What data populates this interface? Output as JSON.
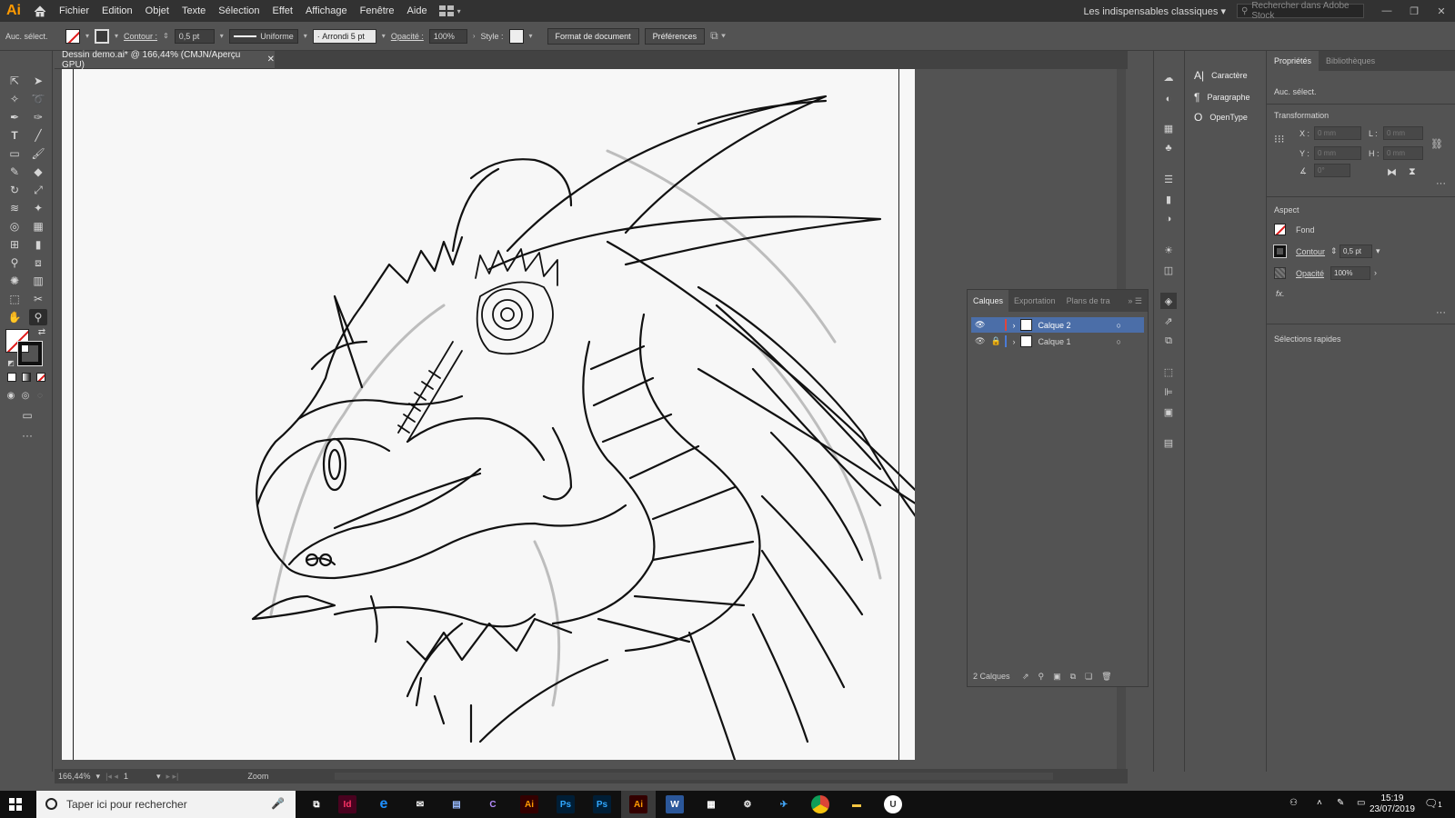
{
  "app": {
    "logo": "Ai",
    "accent": "#ff9a00"
  },
  "menubar": {
    "items": [
      "Fichier",
      "Edition",
      "Objet",
      "Texte",
      "Sélection",
      "Effet",
      "Affichage",
      "Fenêtre",
      "Aide"
    ],
    "workspace": "Les indispensables classiques",
    "stock_search_placeholder": "Rechercher dans Adobe Stock"
  },
  "controlbar": {
    "selection": "Auc. sélect.",
    "contour_label": "Contour :",
    "contour_value": "0,5 pt",
    "stroke_profile": "Uniforme",
    "brush": "Arrondi 5 pt",
    "opacity_label": "Opacité :",
    "opacity_value": "100%",
    "style_label": "Style :",
    "doc_format_button": "Format de document",
    "preferences_button": "Préférences"
  },
  "document": {
    "tab_title": "Dessin demo.ai* @ 166,44% (CMJN/Aperçu GPU)"
  },
  "statusbar": {
    "zoom": "166,44%",
    "artboard": "1",
    "tool": "Zoom"
  },
  "layers_panel": {
    "tabs": [
      "Calques",
      "Exportation",
      "Plans de tra"
    ],
    "layers": [
      {
        "name": "Calque 2",
        "selected": true,
        "color": "#e0463c",
        "locked": false
      },
      {
        "name": "Calque 1",
        "selected": false,
        "color": "#4b7bd6",
        "locked": true
      }
    ],
    "count": "2 Calques"
  },
  "char_panel": {
    "items": [
      "Caractère",
      "Paragraphe",
      "OpenType"
    ]
  },
  "properties": {
    "tabs": [
      "Propriétés",
      "Bibliothèques"
    ],
    "selection": "Auc. sélect.",
    "transform_heading": "Transformation",
    "x_label": "X :",
    "y_label": "Y :",
    "l_label": "L :",
    "h_label": "H :",
    "x_value": "0 mm",
    "y_value": "0 mm",
    "l_value": "0 mm",
    "h_value": "0 mm",
    "angle_value": "0°",
    "aspect_heading": "Aspect",
    "fill_label": "Fond",
    "stroke_label": "Contour",
    "stroke_value": "0,5 pt",
    "opacity_label": "Opacité",
    "opacity_value": "100%",
    "fx_label": "fx.",
    "quick_heading": "Sélections rapides"
  },
  "taskbar": {
    "search_placeholder": "Taper ici pour rechercher",
    "time": "15:19",
    "date": "23/07/2019",
    "notification_count": "1"
  }
}
